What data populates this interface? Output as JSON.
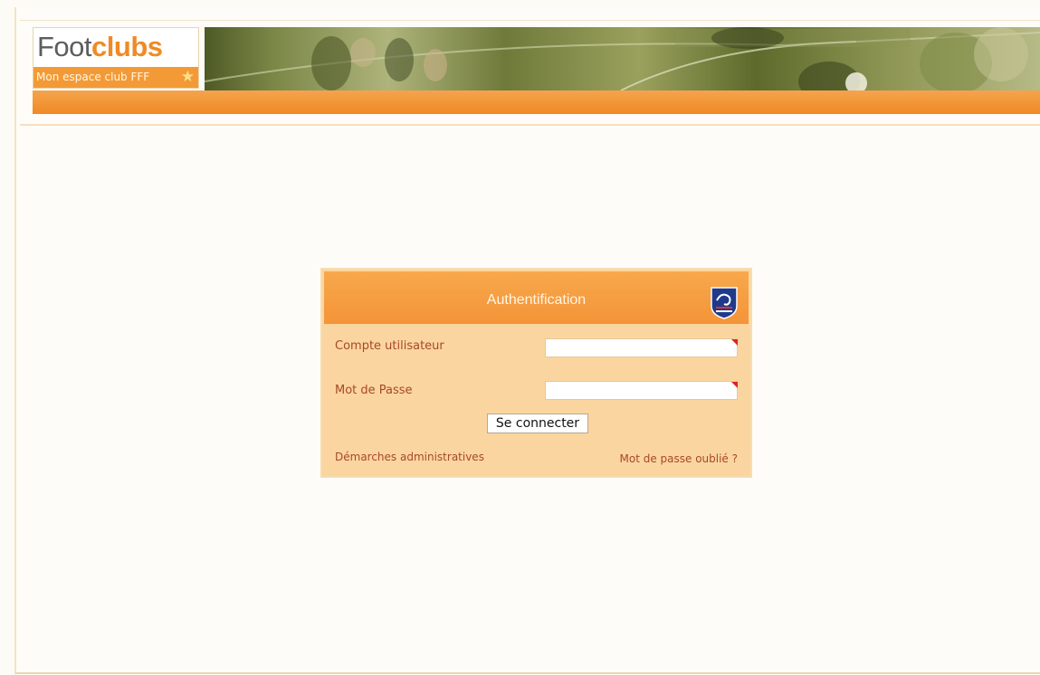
{
  "logo": {
    "brand_part1": "Foot",
    "brand_part2": "clubs",
    "tagline": "Mon espace club FFF",
    "star_icon": "star-icon"
  },
  "colors": {
    "accent_orange": "#f08a24",
    "panel_bg": "#fbd59f",
    "label_text": "#a6482c"
  },
  "login": {
    "title": "Authentification",
    "username_label": "Compte utilisateur",
    "username_value": "",
    "password_label": "Mot de Passe",
    "password_value": "",
    "submit_label": "Se connecter",
    "link_admin": "Démarches administratives",
    "link_forgot": "Mot de passe oublié ?",
    "badge_icon": "fff-logo-icon"
  }
}
